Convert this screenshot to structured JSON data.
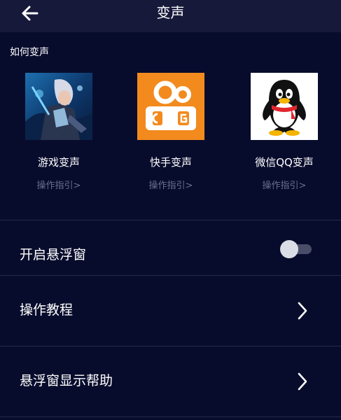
{
  "header": {
    "title": "变声"
  },
  "section": {
    "label": "如何变声"
  },
  "apps": [
    {
      "name": "游戏变声",
      "guide": "操作指引>",
      "icon": "game-hero-art-icon"
    },
    {
      "name": "快手变声",
      "guide": "操作指引>",
      "icon": "kuaishou-logo-icon"
    },
    {
      "name": "微信QQ变声",
      "guide": "操作指引>",
      "icon": "qq-penguin-icon"
    }
  ],
  "settings": {
    "floating_window": {
      "label": "开启悬浮窗",
      "enabled": false
    },
    "tutorial": {
      "label": "操作教程"
    },
    "help": {
      "label": "悬浮窗显示帮助"
    }
  },
  "colors": {
    "background": "#080c2c",
    "header": "#16193a",
    "divider": "#23274c",
    "guide_text": "#6b6e8e",
    "kuaishou": "#f28a1e",
    "qq_scarf": "#e0262d"
  }
}
